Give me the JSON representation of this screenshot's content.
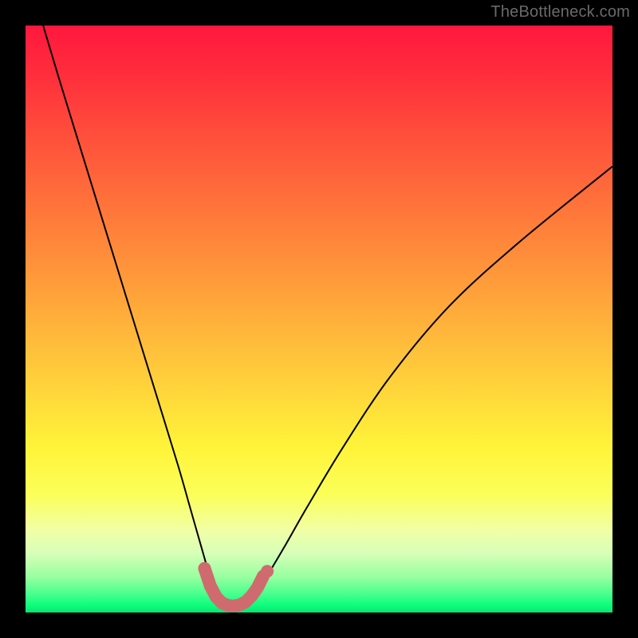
{
  "watermark": "TheBottleneck.com",
  "chart_data": {
    "type": "line",
    "title": "",
    "xlabel": "",
    "ylabel": "",
    "xlim": [
      0,
      100
    ],
    "ylim": [
      0,
      100
    ],
    "series": [
      {
        "name": "bottleneck-curve",
        "x": [
          3,
          6,
          10,
          14,
          18,
          22,
          26,
          28,
          30,
          31.5,
          33,
          34.5,
          36,
          37.5,
          39,
          41,
          44,
          48,
          54,
          62,
          72,
          84,
          100
        ],
        "y": [
          100,
          90,
          77,
          64,
          51,
          38,
          25,
          18,
          11,
          6,
          3,
          1.5,
          1,
          1.6,
          3.2,
          6,
          11,
          18,
          28,
          40,
          52,
          63,
          76
        ]
      }
    ],
    "markers": {
      "name": "highlight-band",
      "color": "#cf6b6f",
      "x": [
        30.5,
        31.5,
        32.5,
        33.5,
        34.5,
        35.5,
        36.5,
        37.5,
        38.5,
        39.5,
        40.5
      ],
      "y": [
        7.5,
        4.5,
        2.6,
        1.6,
        1.2,
        1.1,
        1.3,
        1.8,
        2.8,
        4.2,
        6.2
      ]
    }
  },
  "colors": {
    "curve": "#000000",
    "marker": "#cf6b6f",
    "background_frame": "#000000"
  }
}
